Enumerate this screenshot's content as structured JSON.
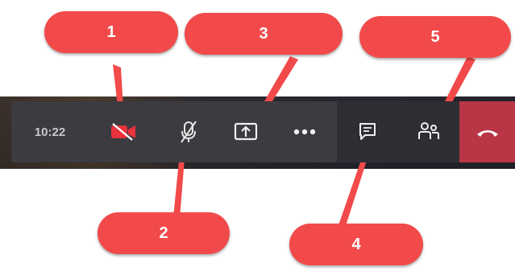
{
  "toolbar": {
    "clock": "10:22",
    "buttons": [
      {
        "icon": "video-camera-icon"
      },
      {
        "icon": "microphone-muted-icon"
      },
      {
        "icon": "share-screen-icon"
      },
      {
        "icon": "more-options-icon"
      },
      {
        "icon": "chat-icon"
      },
      {
        "icon": "participants-icon"
      },
      {
        "icon": "hang-up-icon"
      }
    ]
  },
  "callouts": [
    "1",
    "2",
    "3",
    "4",
    "5"
  ],
  "colors": {
    "callout": "#f24a4a",
    "toolbar": "#3b3b40",
    "hangup": "#b93646",
    "camera_accent": "#e8323c"
  }
}
